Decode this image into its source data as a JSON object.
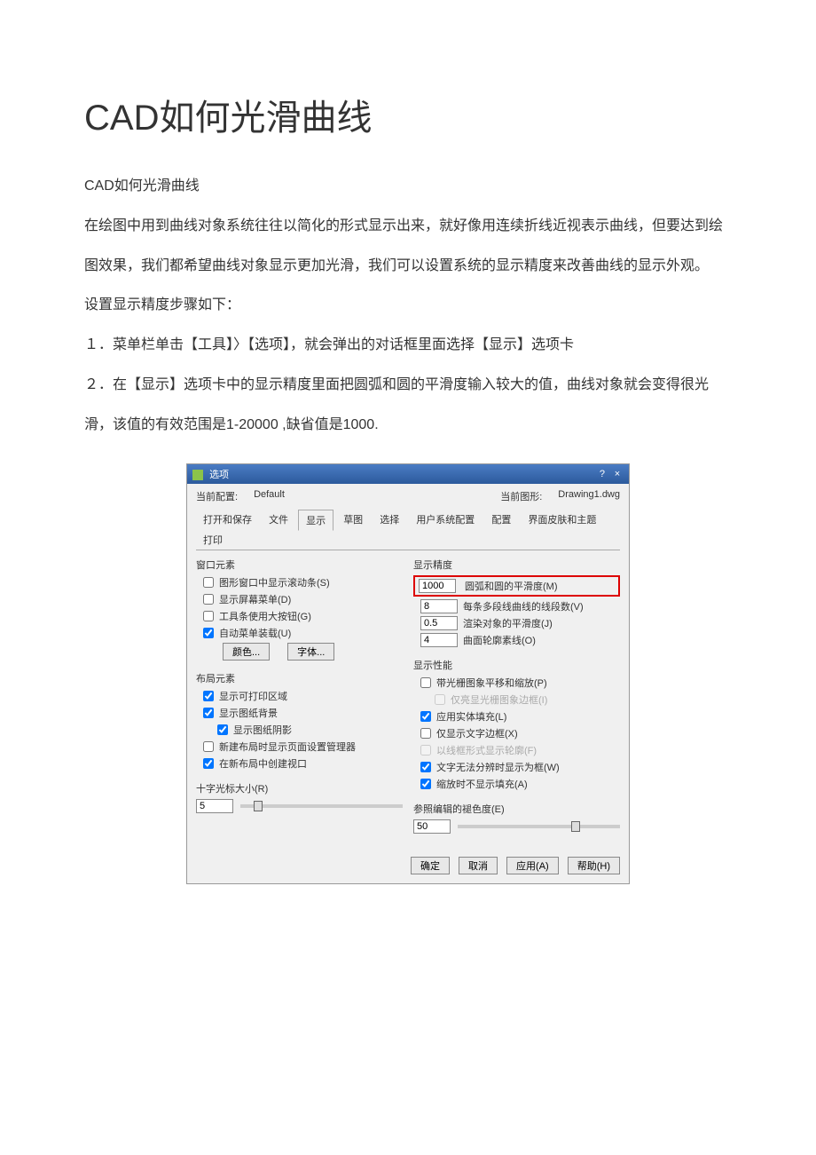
{
  "article": {
    "title": "CAD如何光滑曲线",
    "p1": "CAD如何光滑曲线",
    "p2": "在绘图中用到曲线对象系统往往以简化的形式显示出来，就好像用连续折线近视表示曲线，但要达到绘图效果，我们都希望曲线对象显示更加光滑，我们可以设置系统的显示精度来改善曲线的显示外观。",
    "p3": "设置显示精度步骤如下：",
    "p4": "１．菜单栏单击【工具】〉【选项】，就会弹出的对话框里面选择【显示】选项卡",
    "p5": "２．在【显示】选项卡中的显示精度里面把圆弧和圆的平滑度输入较大的值，曲线对象就会变得很光滑，该值的有效范围是1-20000 ,缺省值是1000."
  },
  "dialog": {
    "title": "选项",
    "win_close": "×",
    "win_help": "?",
    "current_config_label": "当前配置:",
    "current_config_value": "Default",
    "current_drawing_label": "当前图形:",
    "current_drawing_value": "Drawing1.dwg",
    "tabs": [
      "打开和保存",
      "文件",
      "显示",
      "草图",
      "选择",
      "用户系统配置",
      "配置",
      "界面皮肤和主题",
      "打印"
    ],
    "left": {
      "group1_title": "窗口元素",
      "cb1": "图形窗口中显示滚动条(S)",
      "cb2": "显示屏幕菜单(D)",
      "cb3": "工具条使用大按钮(G)",
      "cb4": "自动菜单装载(U)",
      "btn_color": "颜色...",
      "btn_font": "字体...",
      "group2_title": "布局元素",
      "lb1": "显示可打印区域",
      "lb2": "显示图纸背景",
      "lb3": "显示图纸阴影",
      "lb4": "新建布局时显示页面设置管理器",
      "lb5": "在新布局中创建视口",
      "cross_label": "十字光标大小(R)",
      "cross_val": "5"
    },
    "right": {
      "group1_title": "显示精度",
      "r1_val": "1000",
      "r1_label": "圆弧和圆的平滑度(M)",
      "r2_val": "8",
      "r2_label": "每条多段线曲线的线段数(V)",
      "r3_val": "0.5",
      "r3_label": "渲染对象的平滑度(J)",
      "r4_val": "4",
      "r4_label": "曲面轮廓素线(O)",
      "group2_title": "显示性能",
      "p1": "带光栅图象平移和缩放(P)",
      "p2": "仅亮显光栅图象边框(I)",
      "p3": "应用实体填充(L)",
      "p4": "仅显示文字边框(X)",
      "p5": "以线框形式显示轮廓(F)",
      "p6": "文字无法分辨时显示为框(W)",
      "p7": "缩放时不显示填充(A)",
      "fade_label": "参照编辑的褪色度(E)",
      "fade_val": "50"
    },
    "actions": {
      "ok": "确定",
      "cancel": "取消",
      "apply": "应用(A)",
      "help": "帮助(H)"
    }
  }
}
